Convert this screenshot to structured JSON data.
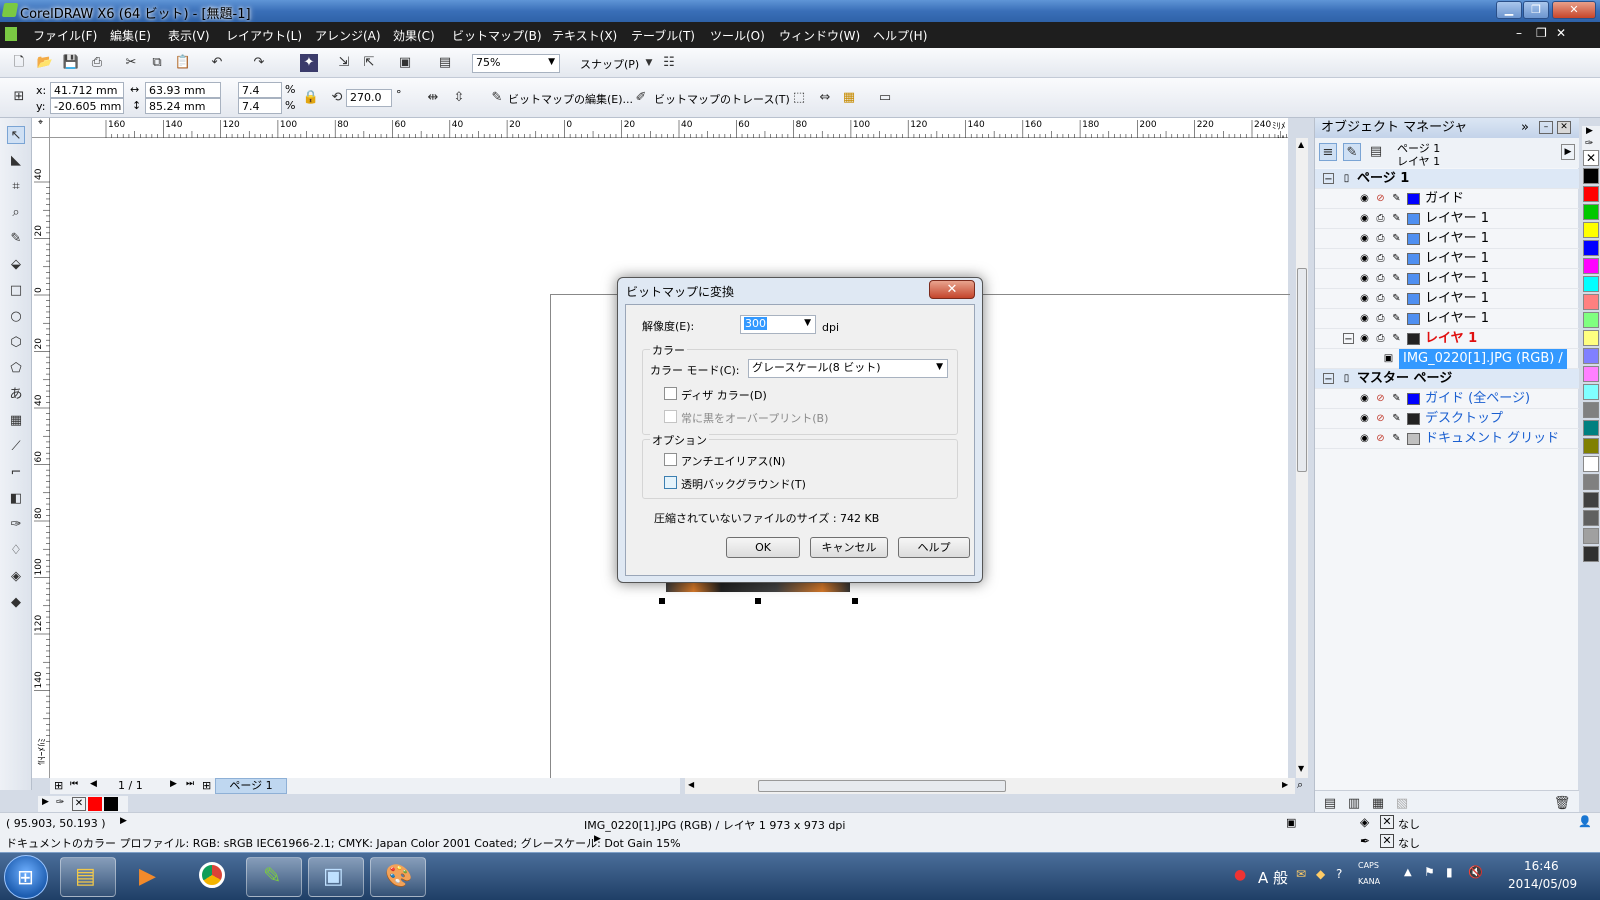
{
  "window": {
    "title": "CorelDRAW X6 (64 ビット) - [無題-1]"
  },
  "menu": [
    "ファイル(F)",
    "編集(E)",
    "表示(V)",
    "レイアウト(L)",
    "アレンジ(A)",
    "効果(C)",
    "ビットマップ(B)",
    "テキスト(X)",
    "テーブル(T)",
    "ツール(O)",
    "ウィンドウ(W)",
    "ヘルプ(H)"
  ],
  "toolbar": {
    "zoom": "75%",
    "snap": "スナップ(P)"
  },
  "props": {
    "x": "41.712 mm",
    "y": "-20.605 mm",
    "w": "63.93 mm",
    "h": "85.24 mm",
    "sx": "7.4",
    "sy": "7.4",
    "pct": "%",
    "angle": "270.0",
    "deg": "°",
    "xl": "x:",
    "yl": "y:",
    "edit_bitmap": "ビットマップの編集(E)...",
    "trace_bitmap": "ビットマップのトレース(T)"
  },
  "ruler": {
    "h_ticks": [
      "160",
      "140",
      "120",
      "100",
      "80",
      "60",
      "40",
      "20",
      "0",
      "20",
      "40",
      "60",
      "80",
      "100",
      "120",
      "140",
      "160",
      "180",
      "200",
      "220",
      "240"
    ],
    "h_unit": "ﾐﾘﾒｰﾄﾙ",
    "v_ticks": [
      "40",
      "20",
      "0",
      "20",
      "40",
      "60",
      "80",
      "100",
      "120",
      "140"
    ],
    "v_unit": "ﾐﾘﾒｰﾄﾙ"
  },
  "page_nav": {
    "pages": "1 / 1",
    "tab": "ページ 1"
  },
  "docker": {
    "title": "オブジェクト マネージャ",
    "page_label": "ページ 1",
    "layer_label": "レイヤ 1",
    "rows": [
      {
        "name": "ページ 1",
        "color": "",
        "indent": "0",
        "kind": "header"
      },
      {
        "name": "ガイド",
        "color": "#0000ff",
        "indent": "1",
        "kind": "guide"
      },
      {
        "name": "レイヤー 1",
        "color": "#4f8ff0",
        "indent": "1",
        "kind": "layer"
      },
      {
        "name": "レイヤー 1",
        "color": "#4f8ff0",
        "indent": "1",
        "kind": "layer"
      },
      {
        "name": "レイヤー 1",
        "color": "#4f8ff0",
        "indent": "1",
        "kind": "layer"
      },
      {
        "name": "レイヤー 1",
        "color": "#4f8ff0",
        "indent": "1",
        "kind": "layer"
      },
      {
        "name": "レイヤー 1",
        "color": "#4f8ff0",
        "indent": "1",
        "kind": "layer"
      },
      {
        "name": "レイヤー 1",
        "color": "#4f8ff0",
        "indent": "1",
        "kind": "layer"
      },
      {
        "name": "レイヤ 1",
        "color": "#222222",
        "indent": "1",
        "kind": "active"
      },
      {
        "name": "IMG_0220[1].JPG (RGB) /",
        "color": "",
        "indent": "2",
        "kind": "object"
      },
      {
        "name": "マスター ページ",
        "color": "",
        "indent": "0",
        "kind": "header"
      },
      {
        "name": "ガイド (全ページ)",
        "color": "#0000ff",
        "indent": "1",
        "kind": "master"
      },
      {
        "name": "デスクトップ",
        "color": "#222222",
        "indent": "1",
        "kind": "master"
      },
      {
        "name": "ドキュメント グリッド",
        "color": "#c0c0c0",
        "indent": "1",
        "kind": "master"
      }
    ]
  },
  "palette": [
    "#000000",
    "#ff0000",
    "#00c800",
    "#ffff00",
    "#0000ff",
    "#ff00ff",
    "#00ffff",
    "#ff8080",
    "#80ff80",
    "#ffff80",
    "#8080ff",
    "#ff80ff",
    "#80ffff",
    "#808080",
    "#008080",
    "#808000",
    "#ffffff",
    "#808080",
    "#404040",
    "#606060",
    "#a0a0a0",
    "#303030"
  ],
  "status": {
    "coords": "( 95.903, 50.193 )",
    "object": "IMG_0220[1].JPG (RGB) / レイヤ 1 973 x 973 dpi",
    "fill": "なし",
    "outline": "なし",
    "profile": "ドキュメントのカラー プロファイル: RGB: sRGB IEC61966-2.1; CMYK: Japan Color 2001 Coated; グレースケール: Dot Gain 15%"
  },
  "dialog": {
    "title": "ビットマップに変換",
    "resolution_label": "解像度(E):",
    "resolution_value": "300",
    "resolution_unit": "dpi",
    "color_group": "カラー",
    "color_mode_label": "カラー モード(C):",
    "color_mode_value": "グレースケール(8 ビット)",
    "dither": "ディザ カラー(D)",
    "overprint": "常に黒をオーバープリント(B)",
    "options_group": "オプション",
    "antialias": "アンチエイリアス(N)",
    "transparent": "透明バックグラウンド(T)",
    "filesize": "圧縮されていないファイルのサイズ : 742 KB",
    "ok": "OK",
    "cancel": "キャンセル",
    "help": "ヘルプ"
  },
  "tray": {
    "ime": "A 般",
    "time": "16:46",
    "date": "2014/05/09",
    "caps": "CAPS",
    "kana": "KANA"
  }
}
